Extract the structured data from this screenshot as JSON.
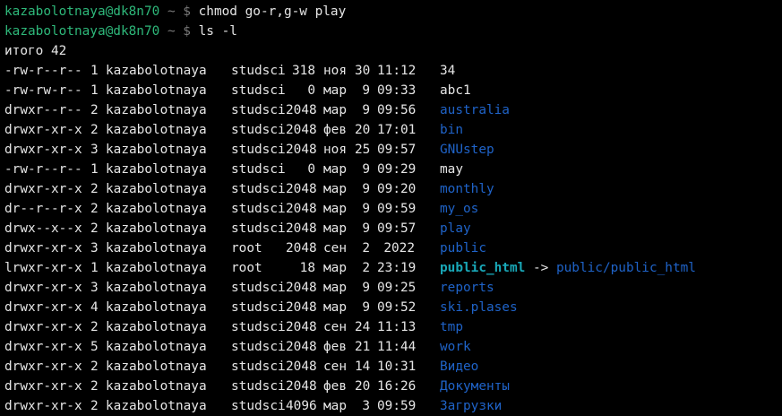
{
  "terminal": {
    "prompts": [
      {
        "user": "kazabolotnaya@dk8n70",
        "dir": "~",
        "symbol": "$",
        "command": "chmod go-r,g-w play"
      },
      {
        "user": "kazabolotnaya@dk8n70",
        "dir": "~",
        "symbol": "$",
        "command": "ls -l"
      }
    ],
    "total_line": "итого 42",
    "entries": [
      {
        "perm": "-rw-r--r--",
        "links": "1",
        "owner": "kazabolotnaya",
        "group": "studsci",
        "size": "318",
        "month": "ноя",
        "day": "30",
        "time": "11:12",
        "name": "34",
        "kind": "file"
      },
      {
        "perm": "-rw-rw-r--",
        "links": "1",
        "owner": "kazabolotnaya",
        "group": "studsci",
        "size": "0",
        "month": "мар",
        "day": "9",
        "time": "09:33",
        "name": "abc1",
        "kind": "file"
      },
      {
        "perm": "drwxr--r--",
        "links": "2",
        "owner": "kazabolotnaya",
        "group": "studsci",
        "size": "2048",
        "month": "мар",
        "day": "9",
        "time": "09:56",
        "name": "australia",
        "kind": "dir"
      },
      {
        "perm": "drwxr-xr-x",
        "links": "2",
        "owner": "kazabolotnaya",
        "group": "studsci",
        "size": "2048",
        "month": "фев",
        "day": "20",
        "time": "17:01",
        "name": "bin",
        "kind": "dir"
      },
      {
        "perm": "drwxr-xr-x",
        "links": "3",
        "owner": "kazabolotnaya",
        "group": "studsci",
        "size": "2048",
        "month": "ноя",
        "day": "25",
        "time": "09:57",
        "name": "GNUstep",
        "kind": "dir"
      },
      {
        "perm": "-rw-r--r--",
        "links": "1",
        "owner": "kazabolotnaya",
        "group": "studsci",
        "size": "0",
        "month": "мар",
        "day": "9",
        "time": "09:29",
        "name": "may",
        "kind": "file"
      },
      {
        "perm": "drwxr-xr-x",
        "links": "2",
        "owner": "kazabolotnaya",
        "group": "studsci",
        "size": "2048",
        "month": "мар",
        "day": "9",
        "time": "09:20",
        "name": "monthly",
        "kind": "dir"
      },
      {
        "perm": "dr--r--r-x",
        "links": "2",
        "owner": "kazabolotnaya",
        "group": "studsci",
        "size": "2048",
        "month": "мар",
        "day": "9",
        "time": "09:59",
        "name": "my_os",
        "kind": "dir"
      },
      {
        "perm": "drwx--x--x",
        "links": "2",
        "owner": "kazabolotnaya",
        "group": "studsci",
        "size": "2048",
        "month": "мар",
        "day": "9",
        "time": "09:57",
        "name": "play",
        "kind": "dir"
      },
      {
        "perm": "drwxr-xr-x",
        "links": "3",
        "owner": "kazabolotnaya",
        "group": "root",
        "size": "2048",
        "month": "сен",
        "day": "2",
        "time": "2022",
        "name": "public",
        "kind": "dir"
      },
      {
        "perm": "lrwxr-xr-x",
        "links": "1",
        "owner": "kazabolotnaya",
        "group": "root",
        "size": "18",
        "month": "мар",
        "day": "2",
        "time": "23:19",
        "name": "public_html",
        "kind": "link",
        "arrow": "->",
        "target": "public/public_html"
      },
      {
        "perm": "drwxr-xr-x",
        "links": "3",
        "owner": "kazabolotnaya",
        "group": "studsci",
        "size": "2048",
        "month": "мар",
        "day": "9",
        "time": "09:25",
        "name": "reports",
        "kind": "dir"
      },
      {
        "perm": "drwxr-xr-x",
        "links": "4",
        "owner": "kazabolotnaya",
        "group": "studsci",
        "size": "2048",
        "month": "мар",
        "day": "9",
        "time": "09:52",
        "name": "ski.plases",
        "kind": "dir"
      },
      {
        "perm": "drwxr-xr-x",
        "links": "2",
        "owner": "kazabolotnaya",
        "group": "studsci",
        "size": "2048",
        "month": "сен",
        "day": "24",
        "time": "11:13",
        "name": "tmp",
        "kind": "dir"
      },
      {
        "perm": "drwxr-xr-x",
        "links": "5",
        "owner": "kazabolotnaya",
        "group": "studsci",
        "size": "2048",
        "month": "фев",
        "day": "21",
        "time": "11:44",
        "name": "work",
        "kind": "dir"
      },
      {
        "perm": "drwxr-xr-x",
        "links": "2",
        "owner": "kazabolotnaya",
        "group": "studsci",
        "size": "2048",
        "month": "сен",
        "day": "14",
        "time": "10:31",
        "name": "Видео",
        "kind": "dir"
      },
      {
        "perm": "drwxr-xr-x",
        "links": "2",
        "owner": "kazabolotnaya",
        "group": "studsci",
        "size": "2048",
        "month": "фев",
        "day": "20",
        "time": "16:26",
        "name": "Документы",
        "kind": "dir"
      },
      {
        "perm": "drwxr-xr-x",
        "links": "2",
        "owner": "kazabolotnaya",
        "group": "studsci",
        "size": "4096",
        "month": "мар",
        "day": "3",
        "time": "09:59",
        "name": "Загрузки",
        "kind": "dir"
      }
    ]
  }
}
